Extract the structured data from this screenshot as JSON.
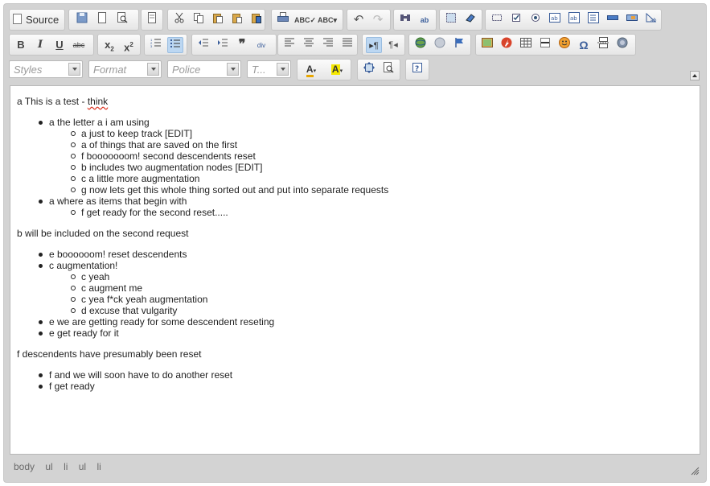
{
  "toolbar": {
    "source_label": "Source",
    "styles_placeholder": "Styles",
    "format_placeholder": "Format",
    "font_placeholder": "Police",
    "size_placeholder": "T..."
  },
  "content": {
    "para1_prefix": "a This is a test - ",
    "para1_word": "think",
    "list1": [
      {
        "text": "a the letter a i am using"
      },
      {
        "text": "a just to keep track [EDIT]"
      },
      {
        "text": "a of things that are saved on the first"
      },
      {
        "text": "f booooooom! second descendents reset"
      },
      {
        "text": "b includes two augmentation nodes [EDIT]"
      },
      {
        "text": "c a little more augmentation"
      },
      {
        "text": "g now lets get this whole thing sorted out and put into separate requests"
      },
      {
        "text": "a where as items that begin with"
      },
      {
        "text": "f get ready for the second reset....."
      }
    ],
    "para2": "b will be included on the second request",
    "list2": [
      {
        "text": "e boooooom! reset descendents"
      },
      {
        "text": "c augmentation!"
      },
      {
        "text": "c yeah"
      },
      {
        "text": "c augment me"
      },
      {
        "text": "c yea f*ck yeah augmentation"
      },
      {
        "text": "d excuse that vulgarity"
      },
      {
        "text": "e we are getting ready for some descendent reseting"
      },
      {
        "text": "e get ready for it"
      }
    ],
    "para3": "f descendents have presumably been reset",
    "list3": [
      {
        "text": "f and we will soon have to do another reset"
      },
      {
        "text": "f get ready"
      }
    ]
  },
  "statusbar": {
    "path": [
      "body",
      "ul",
      "li",
      "ul",
      "li"
    ]
  }
}
